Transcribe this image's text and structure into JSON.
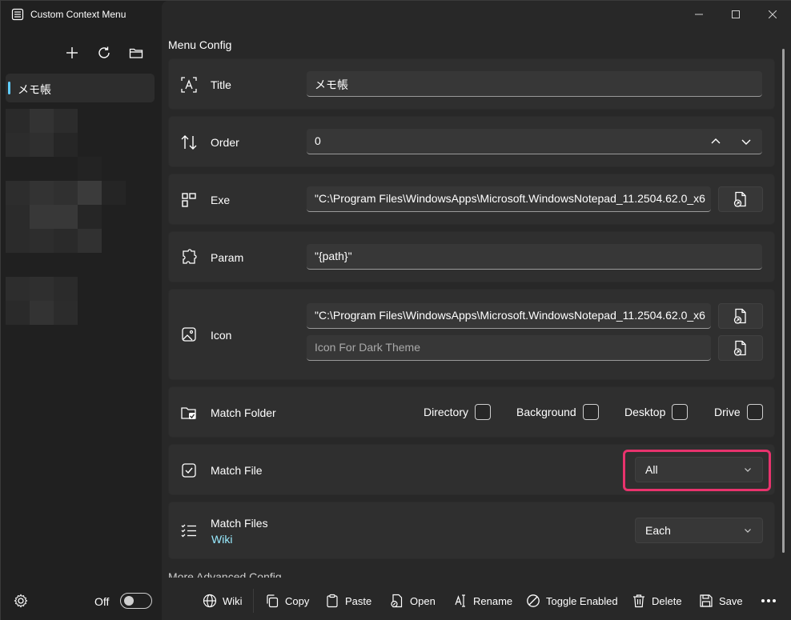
{
  "window": {
    "title": "Custom Context Menu"
  },
  "sidebar": {
    "items": [
      {
        "label": "メモ帳",
        "selected": true
      }
    ],
    "status": {
      "label": "Off",
      "toggle_on": false
    }
  },
  "main": {
    "section_title": "Menu Config",
    "fields": {
      "title": {
        "label": "Title",
        "value": "メモ帳"
      },
      "order": {
        "label": "Order",
        "value": "0"
      },
      "exe": {
        "label": "Exe",
        "value": "\"C:\\Program Files\\WindowsApps\\Microsoft.WindowsNotepad_11.2504.62.0_x6"
      },
      "param": {
        "label": "Param",
        "value": "\"{path}\""
      },
      "icon": {
        "label": "Icon",
        "value": "\"C:\\Program Files\\WindowsApps\\Microsoft.WindowsNotepad_11.2504.62.0_x6",
        "dark_placeholder": "Icon For Dark Theme"
      },
      "match_folder": {
        "label": "Match Folder",
        "options": [
          {
            "label": "Directory",
            "checked": false
          },
          {
            "label": "Background",
            "checked": false
          },
          {
            "label": "Desktop",
            "checked": false
          },
          {
            "label": "Drive",
            "checked": false
          }
        ]
      },
      "match_file": {
        "label": "Match File",
        "selected": "All"
      },
      "match_files": {
        "label": "Match Files",
        "link": "Wiki",
        "selected": "Each"
      }
    },
    "partial_heading": "More Advanced Config"
  },
  "commandbar": {
    "wiki": "Wiki",
    "copy": "Copy",
    "paste": "Paste",
    "open": "Open",
    "rename": "Rename",
    "toggle_enabled": "Toggle Enabled",
    "delete": "Delete",
    "save": "Save"
  },
  "colors": {
    "accent": "#60cdff",
    "link": "#99ebff",
    "highlight": "#e8336d"
  }
}
